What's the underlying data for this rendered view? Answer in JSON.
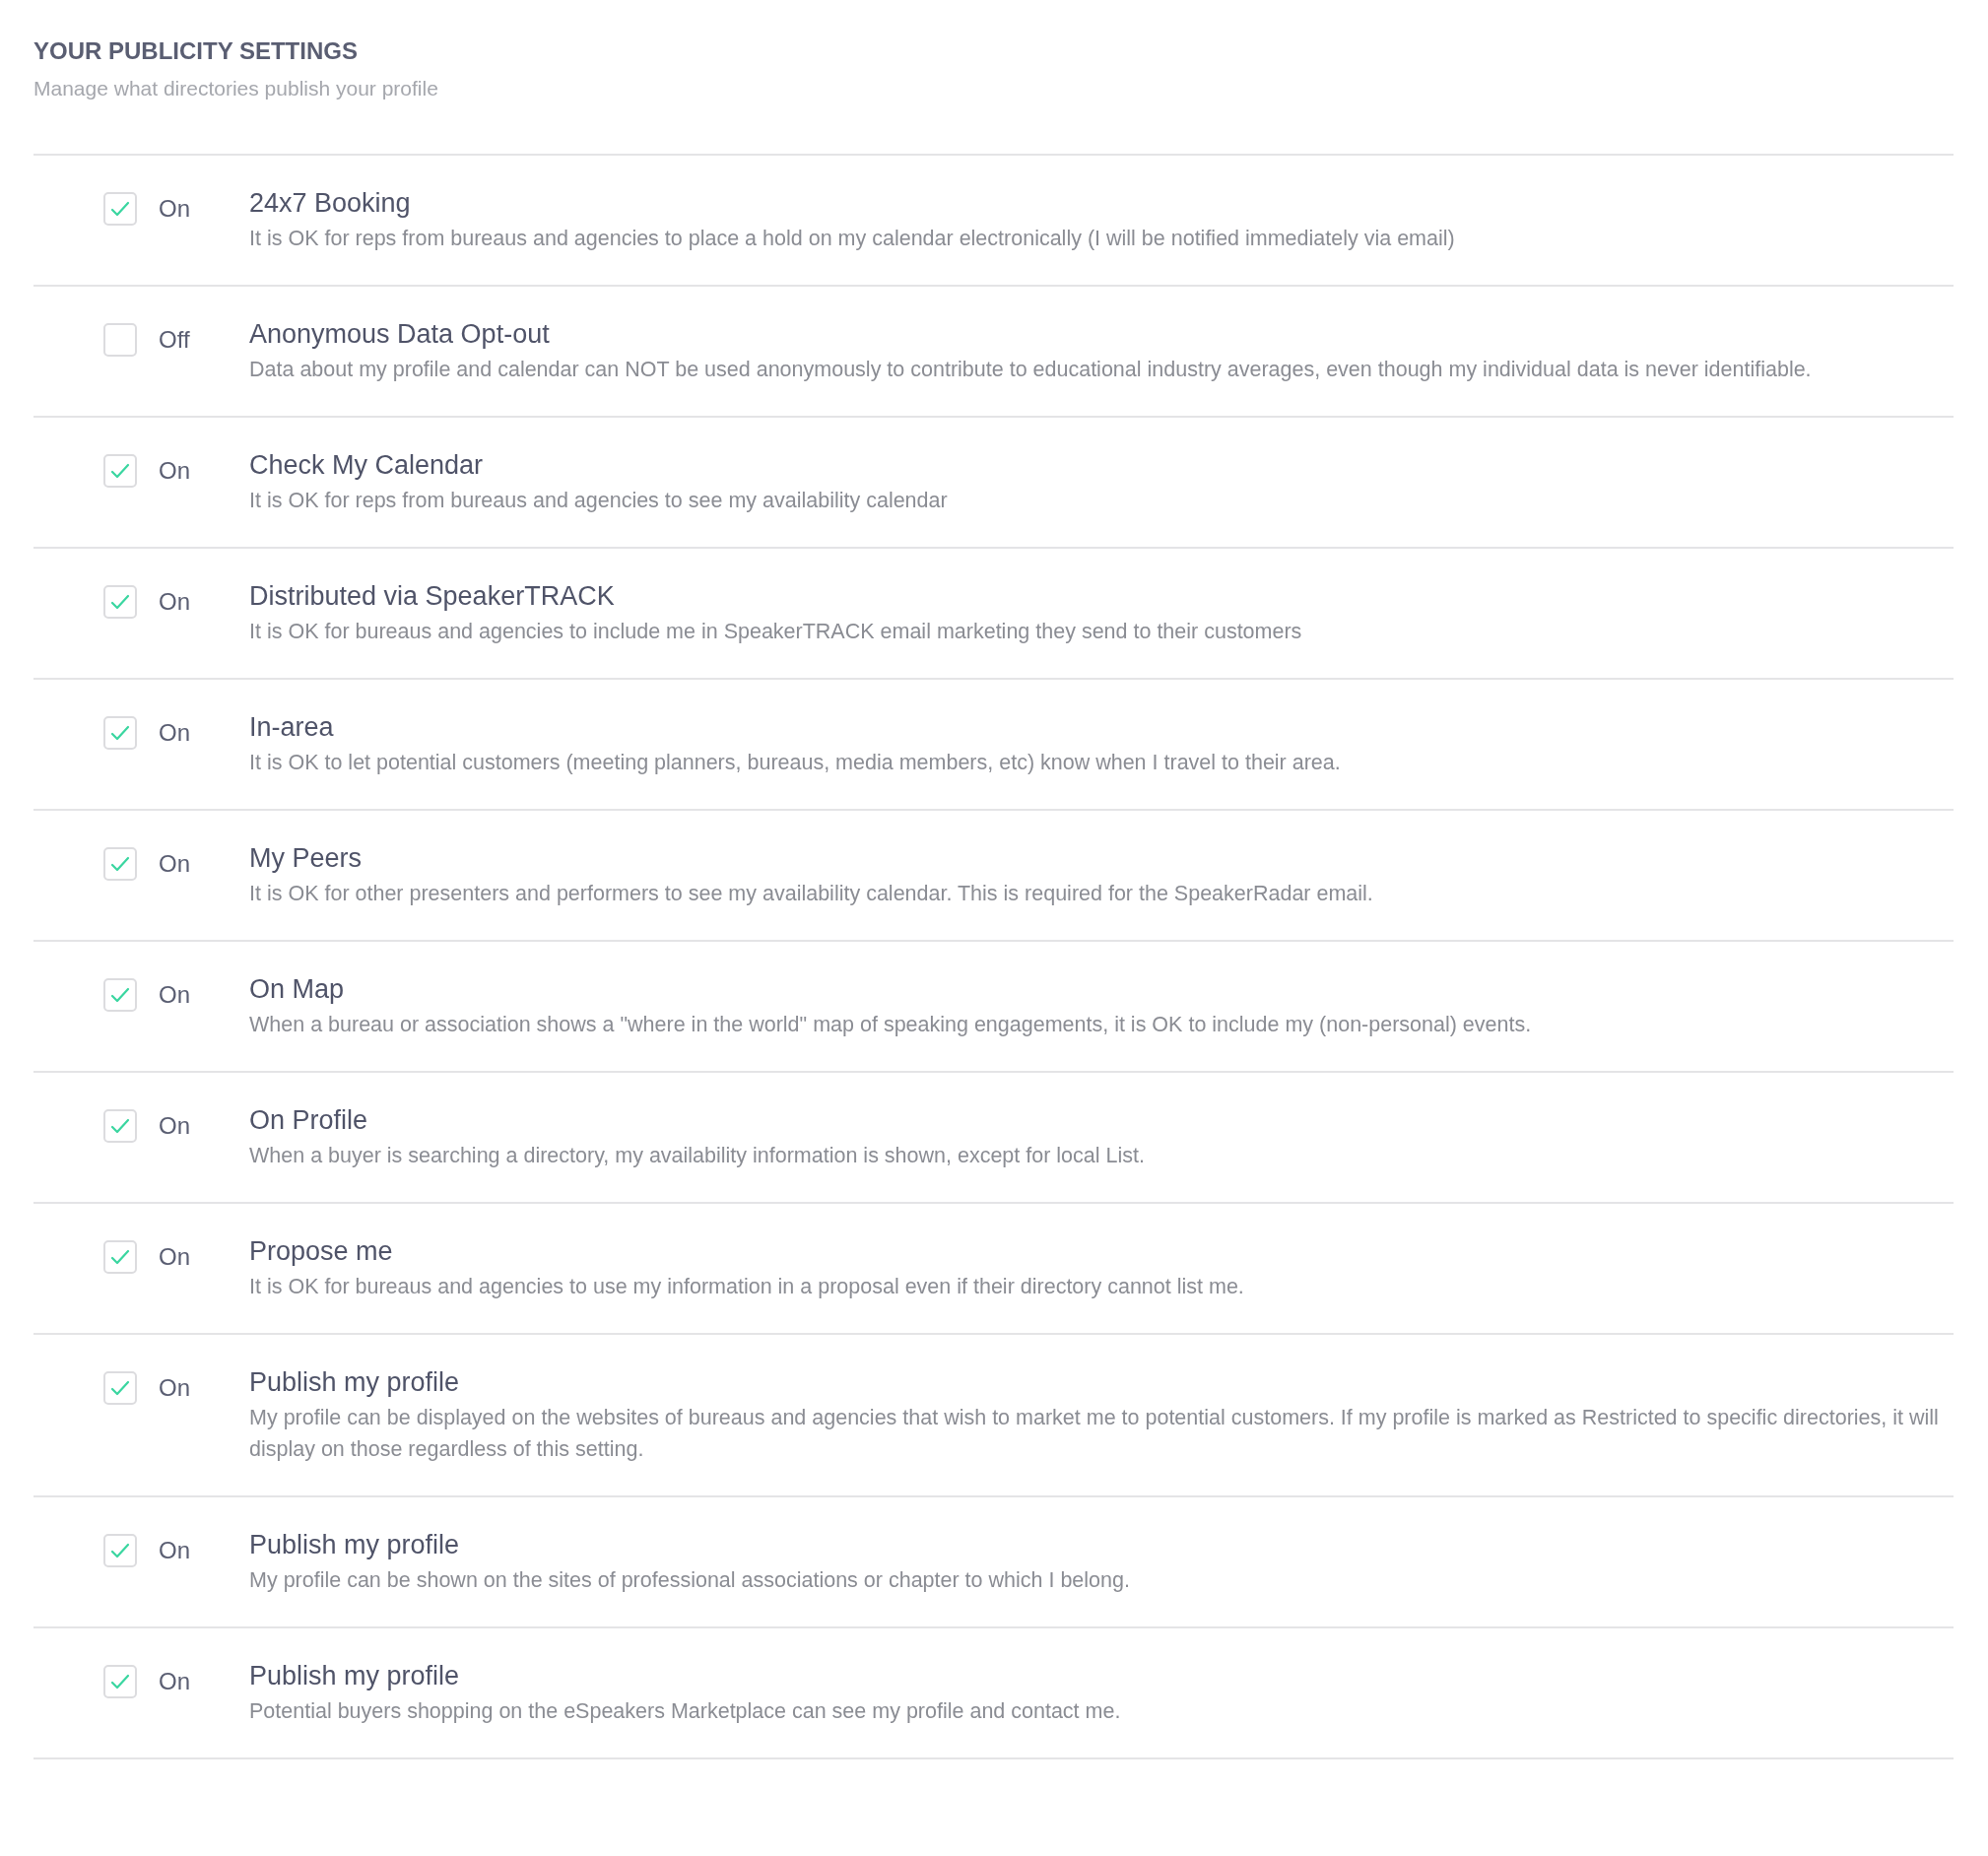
{
  "header": {
    "title": "YOUR PUBLICITY SETTINGS",
    "subtitle": "Manage what directories publish your profile"
  },
  "settings": [
    {
      "checked": true,
      "state_label": "On",
      "name": "24x7 Booking",
      "description": "It is OK for reps from bureaus and agencies to place a hold on my calendar electronically (I will be notified immediately via email)"
    },
    {
      "checked": false,
      "state_label": "Off",
      "name": "Anonymous Data Opt-out",
      "description": "Data about my profile and calendar can NOT be used anonymously to contribute to educational industry averages, even though my individual data is never identifiable."
    },
    {
      "checked": true,
      "state_label": "On",
      "name": "Check My Calendar",
      "description": "It is OK for reps from bureaus and agencies to see my availability calendar"
    },
    {
      "checked": true,
      "state_label": "On",
      "name": "Distributed via SpeakerTRACK",
      "description": "It is OK for bureaus and agencies to include me in SpeakerTRACK email marketing they send to their customers"
    },
    {
      "checked": true,
      "state_label": "On",
      "name": "In-area",
      "description": "It is OK to let potential customers (meeting planners, bureaus, media members, etc) know when I travel to their area."
    },
    {
      "checked": true,
      "state_label": "On",
      "name": "My Peers",
      "description": "It is OK for other presenters and performers to see my availability calendar. This is required for the SpeakerRadar email."
    },
    {
      "checked": true,
      "state_label": "On",
      "name": "On Map",
      "description": "When a bureau or association shows a \"where in the world\" map of speaking engagements, it is OK to include my (non-personal) events."
    },
    {
      "checked": true,
      "state_label": "On",
      "name": "On Profile",
      "description": "When a buyer is searching a directory, my availability information is shown, except for local List."
    },
    {
      "checked": true,
      "state_label": "On",
      "name": "Propose me",
      "description": "It is OK for bureaus and agencies to use my information in a proposal even if their directory cannot list me."
    },
    {
      "checked": true,
      "state_label": "On",
      "name": "Publish my profile",
      "description": "My profile can be displayed on the websites of bureaus and agencies that wish to market me to potential customers. If my profile is marked as Restricted to specific directories, it will display on those regardless of this setting."
    },
    {
      "checked": true,
      "state_label": "On",
      "name": "Publish my profile",
      "description": "My profile can be shown on the sites of professional associations or chapter to which I belong."
    },
    {
      "checked": true,
      "state_label": "On",
      "name": "Publish my profile",
      "description": "Potential buyers shopping on the eSpeakers Marketplace can see my profile and contact me."
    }
  ]
}
